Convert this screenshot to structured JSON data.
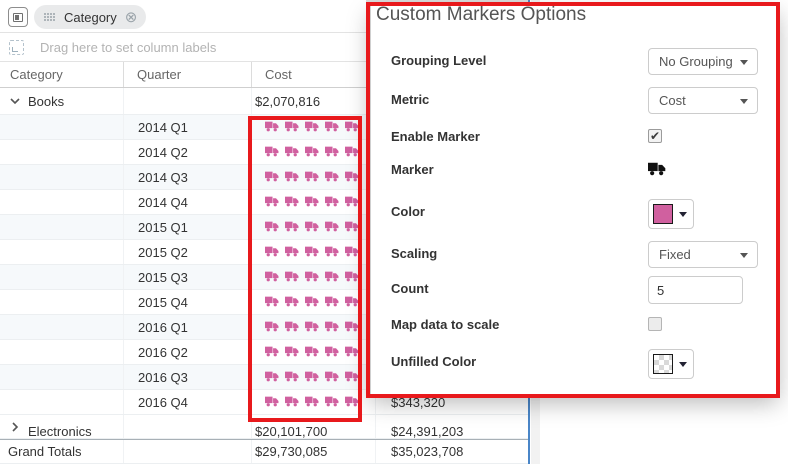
{
  "toolbar": {
    "row_chip": {
      "label": "Category"
    },
    "column_drop_placeholder": "Drag here to set column labels"
  },
  "table": {
    "headers": [
      "Category",
      "Quarter",
      "Cost"
    ],
    "rows": [
      {
        "kind": "category",
        "expanded": true,
        "label": "Books",
        "cost": "$2,070,816"
      },
      {
        "kind": "quarter",
        "label": "2014 Q1",
        "markers": 5
      },
      {
        "kind": "quarter",
        "label": "2014 Q2",
        "markers": 5
      },
      {
        "kind": "quarter",
        "label": "2014 Q3",
        "markers": 5
      },
      {
        "kind": "quarter",
        "label": "2014 Q4",
        "markers": 5
      },
      {
        "kind": "quarter",
        "label": "2015 Q1",
        "markers": 5
      },
      {
        "kind": "quarter",
        "label": "2015 Q2",
        "markers": 5
      },
      {
        "kind": "quarter",
        "label": "2015 Q3",
        "markers": 5
      },
      {
        "kind": "quarter",
        "label": "2015 Q4",
        "markers": 5
      },
      {
        "kind": "quarter",
        "label": "2016 Q1",
        "markers": 5
      },
      {
        "kind": "quarter",
        "label": "2016 Q2",
        "markers": 5
      },
      {
        "kind": "quarter",
        "label": "2016 Q3",
        "markers": 5
      },
      {
        "kind": "quarter",
        "label": "2016 Q4",
        "markers": 5,
        "col2": "$343,320"
      },
      {
        "kind": "category",
        "expanded": false,
        "label": "Electronics",
        "cost": "$20,101,700",
        "col2": "$24,391,203"
      },
      {
        "kind": "total",
        "label": "Grand Totals",
        "cost": "$29,730,085",
        "col2": "$35,023,708"
      }
    ]
  },
  "panel": {
    "title": "Custom Markers Options",
    "fields": [
      {
        "label": "Grouping Level",
        "control": "select",
        "value": "No Grouping"
      },
      {
        "label": "Metric",
        "control": "select",
        "value": "Cost"
      },
      {
        "label": "Enable Marker",
        "control": "checkbox",
        "checked": true
      },
      {
        "label": "Marker",
        "control": "marker-icon",
        "value": "truck-icon"
      },
      {
        "label": "Color",
        "control": "color-select",
        "value": "#d0609f"
      },
      {
        "label": "Scaling",
        "control": "select",
        "value": "Fixed"
      },
      {
        "label": "Count",
        "control": "text-input",
        "value": "5"
      },
      {
        "label": "Map data to scale",
        "control": "checkbox",
        "checked": false
      },
      {
        "label": "Unfilled Color",
        "control": "color-select",
        "value": "checker"
      }
    ]
  },
  "colors": {
    "marker_pink": "#d0609f",
    "marker_black": "#111111",
    "annotation_red": "#e8191c",
    "accent_blue": "#4a86c8"
  }
}
